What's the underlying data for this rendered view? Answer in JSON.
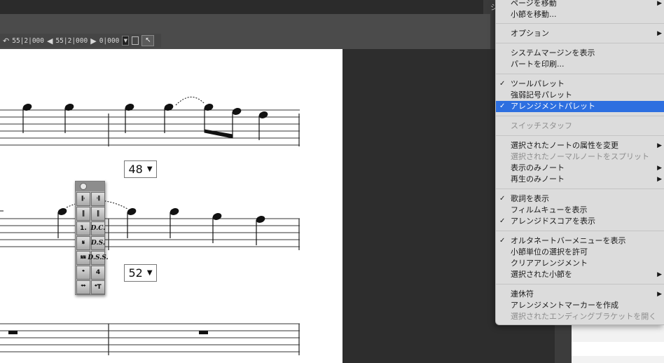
{
  "toolbar": {
    "undo_icon": "undo-icon",
    "field1": "55|2|000",
    "field2": "55|2|000",
    "field3": "0|000",
    "side_glyph": "シ"
  },
  "score": {
    "measure_a": "48",
    "measure_b": "52"
  },
  "palette": {
    "buttons": [
      "𝄆",
      "𝄇",
      "‖",
      "‖",
      "1.",
      "D.C.",
      "𝄋",
      "D.S.",
      "𝄋𝄋",
      "D.S.S.",
      "𝄌",
      "4",
      "𝄌𝄌",
      "𝄌T"
    ]
  },
  "menu": {
    "items": [
      {
        "label": "ページを移動",
        "checked": false,
        "submenu": true,
        "disabled": false
      },
      {
        "label": "小節を移動...",
        "checked": false,
        "submenu": false,
        "disabled": false
      },
      {
        "label": "オプション",
        "checked": false,
        "submenu": true,
        "disabled": false
      },
      {
        "label": "システムマージンを表示",
        "checked": false,
        "submenu": false,
        "disabled": false
      },
      {
        "label": "パートを印刷...",
        "checked": false,
        "submenu": false,
        "disabled": false
      },
      {
        "label": "ツールパレット",
        "checked": true,
        "submenu": false,
        "disabled": false
      },
      {
        "label": "強弱記号パレット",
        "checked": false,
        "submenu": false,
        "disabled": false
      },
      {
        "label": "アレンジメントパレット",
        "checked": true,
        "submenu": false,
        "disabled": false,
        "highlighted": true
      },
      {
        "label": "スイッチスタッフ",
        "checked": false,
        "submenu": false,
        "disabled": true
      },
      {
        "label": "選択されたノートの属性を変更",
        "checked": false,
        "submenu": true,
        "disabled": false
      },
      {
        "label": "選択されたノーマルノートをスプリット",
        "checked": false,
        "submenu": false,
        "disabled": true
      },
      {
        "label": "表示のみノート",
        "checked": false,
        "submenu": true,
        "disabled": false
      },
      {
        "label": "再生のみノート",
        "checked": false,
        "submenu": true,
        "disabled": false
      },
      {
        "label": "歌詞を表示",
        "checked": true,
        "submenu": false,
        "disabled": false
      },
      {
        "label": "フィルムキューを表示",
        "checked": false,
        "submenu": false,
        "disabled": false
      },
      {
        "label": "アレンジドスコアを表示",
        "checked": true,
        "submenu": false,
        "disabled": false
      },
      {
        "label": "オルタネートバーメニューを表示",
        "checked": true,
        "submenu": false,
        "disabled": false
      },
      {
        "label": "小節単位の選択を許可",
        "checked": false,
        "submenu": false,
        "disabled": false
      },
      {
        "label": "クリアアレンジメント",
        "checked": false,
        "submenu": false,
        "disabled": false
      },
      {
        "label": "選択された小節を",
        "checked": false,
        "submenu": true,
        "disabled": false
      },
      {
        "label": "連休符",
        "checked": false,
        "submenu": true,
        "disabled": false
      },
      {
        "label": "アレンジメントマーカーを作成",
        "checked": false,
        "submenu": false,
        "disabled": false
      },
      {
        "label": "選択されたエンディングブラケットを開く",
        "checked": false,
        "submenu": false,
        "disabled": true
      }
    ],
    "check_glyph": "✓",
    "submenu_glyph": "▶"
  }
}
